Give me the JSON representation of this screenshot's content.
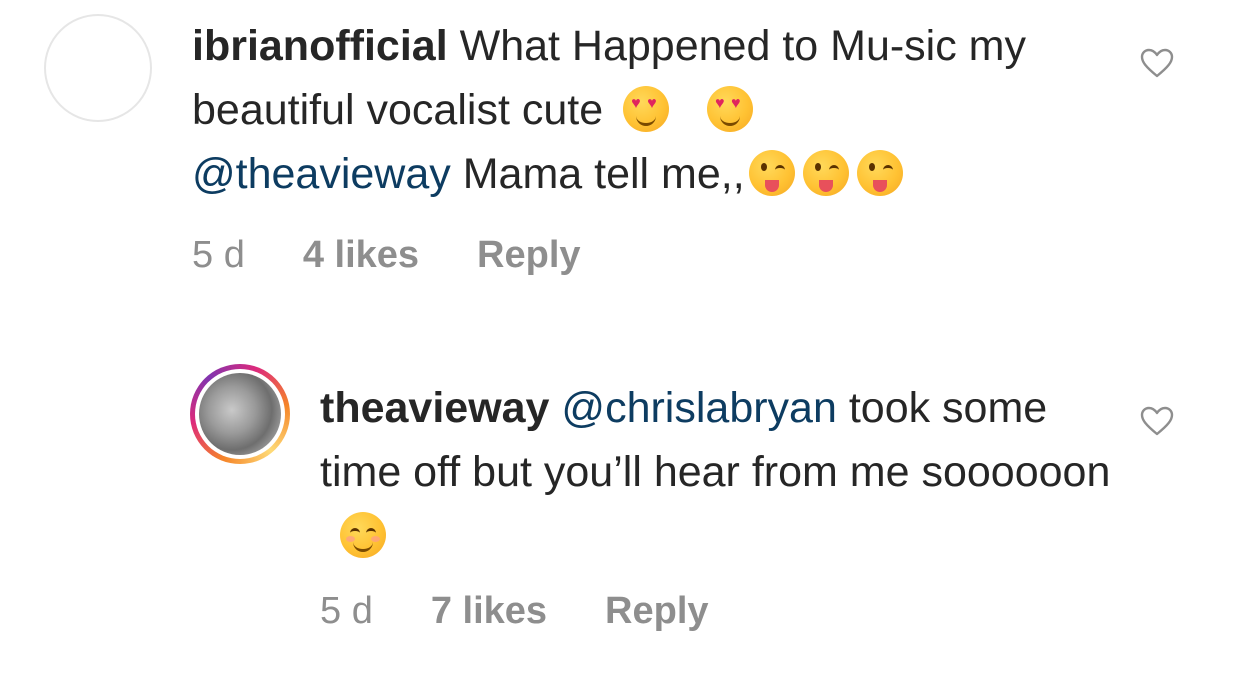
{
  "comments": [
    {
      "username": "ibrianofficial",
      "text_part1": " What Happened to Mu-sic my beautiful vocalist cute",
      "mention": "@theavieway",
      "text_part2": " Mama tell me,,",
      "emojis_line1": [
        "heart-eyes-emoji",
        "heart-eyes-emoji"
      ],
      "emojis_line2": [
        "winking-tongue-emoji",
        "winking-tongue-emoji",
        "winking-tongue-emoji"
      ],
      "age": "5 d",
      "likes": "4 likes",
      "reply_label": "Reply",
      "like_icon": "heart-outline-icon",
      "avatar": "empty-avatar"
    },
    {
      "username": "theavieway",
      "mention": "@chrislabryan",
      "text": " took some time off but you’ll hear from me soooooon",
      "emojis": [
        "smiling-eyes-emoji"
      ],
      "age": "5 d",
      "likes": "7 likes",
      "reply_label": "Reply",
      "like_icon": "heart-outline-icon",
      "avatar": "story-ring-avatar"
    }
  ],
  "colors": {
    "text": "#262626",
    "mention": "#0d3c61",
    "meta": "#8e8e8e"
  }
}
